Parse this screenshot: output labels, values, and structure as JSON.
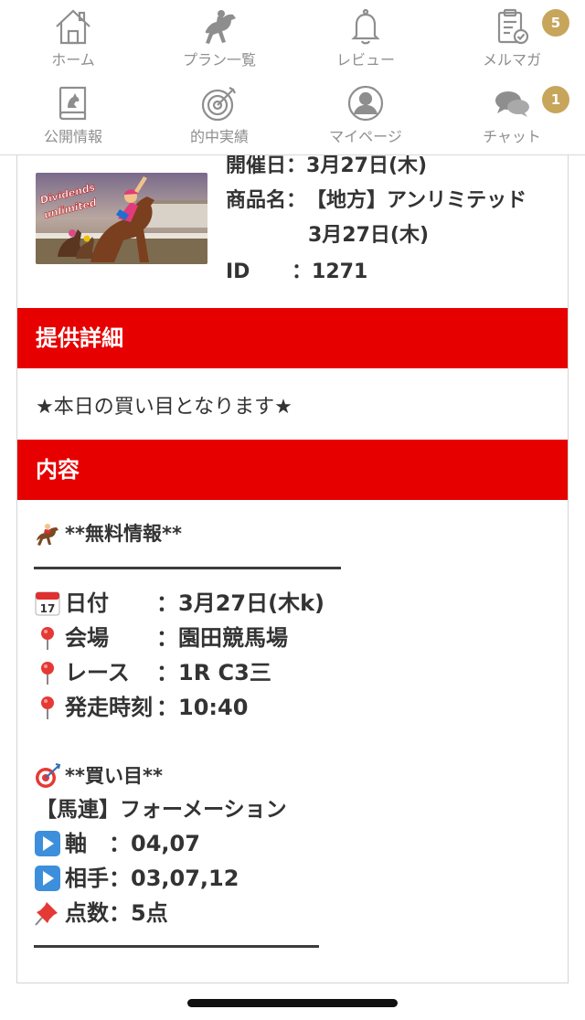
{
  "nav": {
    "items": [
      {
        "label": "ホーム",
        "icon": "home-icon"
      },
      {
        "label": "プラン一覧",
        "icon": "horse-racing-icon"
      },
      {
        "label": "レビュー",
        "icon": "bell-icon"
      },
      {
        "label": "メルマガ",
        "icon": "clipboard-check-icon",
        "badge": "5"
      },
      {
        "label": "公開情報",
        "icon": "horse-book-icon"
      },
      {
        "label": "的中実績",
        "icon": "target-icon"
      },
      {
        "label": "マイページ",
        "icon": "user-icon"
      },
      {
        "label": "チャット",
        "icon": "chat-bubbles-icon",
        "badge": "1"
      }
    ],
    "badge_color": "#c7a55b"
  },
  "product": {
    "thumbnail_text": "Dividends unlimited",
    "date_label": "開催日：",
    "date_value": "3月27日(木)",
    "name_label": "商品名：",
    "name_value_line1": "【地方】アンリミテッド",
    "name_value_line2": "3月27日(木)",
    "id_label": "ID",
    "id_sep": "：",
    "id_value": "1271"
  },
  "detail": {
    "heading": "提供詳細",
    "text": "★本日の買い目となります★"
  },
  "content": {
    "heading": "内容",
    "free_info_title": "**無料情報**",
    "rows": [
      {
        "icon": "calendar-icon",
        "label": "日付",
        "value": "：3月27日(木k)"
      },
      {
        "icon": "pin-icon",
        "label": "会場",
        "value": "：園田競馬場"
      },
      {
        "icon": "pin-icon",
        "label": "レース",
        "value": "：1R C3三"
      },
      {
        "icon": "pin-icon",
        "label": "発走時刻",
        "value": "：10:40"
      }
    ],
    "buy_title": "**買い目**",
    "bet_type": "【馬連】フォーメーション",
    "axis": "軸　：04,07",
    "partner": "相手：03,07,12",
    "points": "点数：5点"
  },
  "colors": {
    "accent_red": "#e60000",
    "icon_gray": "#8e8e8e"
  }
}
